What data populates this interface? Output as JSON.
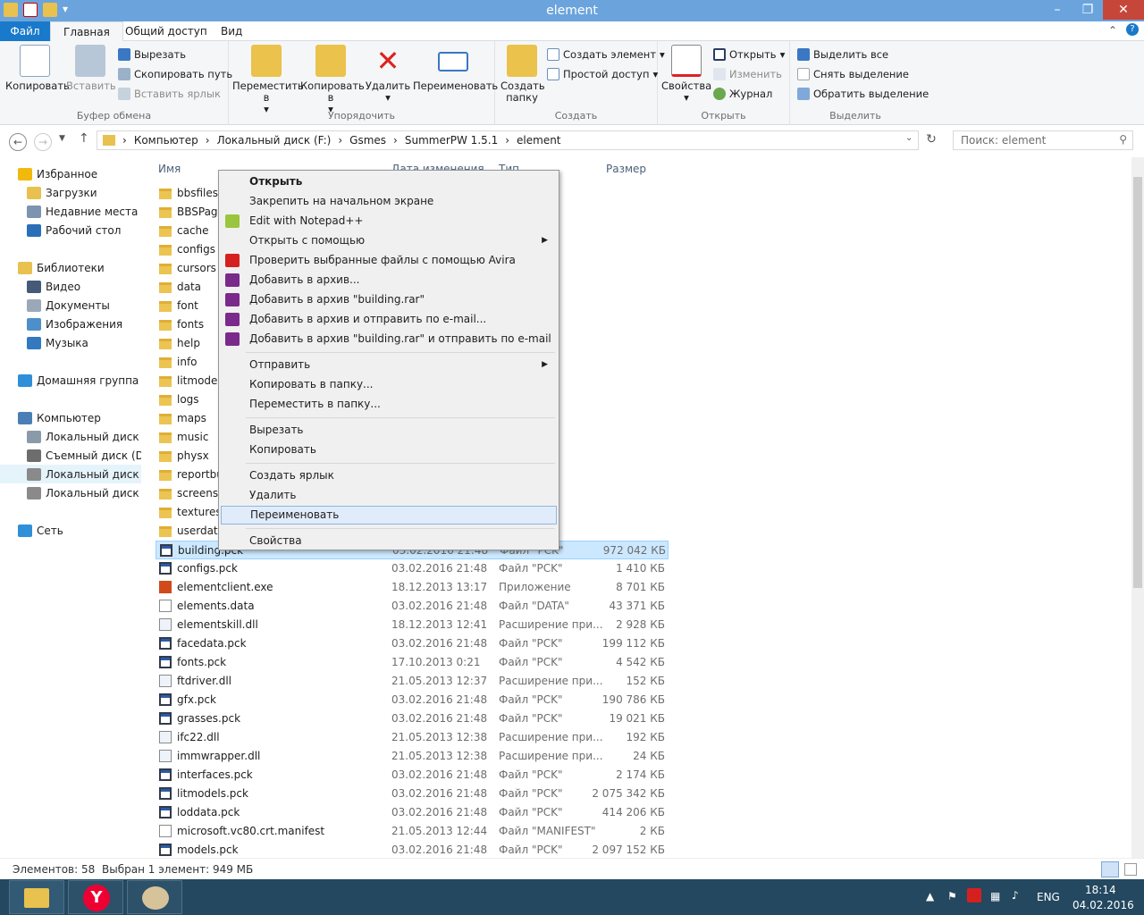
{
  "window": {
    "title": "element",
    "min": "–",
    "max": "❐",
    "close": "✕"
  },
  "menu": {
    "file": "Файл",
    "tabs": [
      "Главная",
      "Общий доступ",
      "Вид"
    ]
  },
  "ribbon": {
    "clipboard": {
      "label": "Буфер обмена",
      "copy": "Копировать",
      "paste": "Вставить",
      "cut": "Вырезать",
      "copy_path": "Скопировать путь",
      "paste_shortcut": "Вставить ярлык"
    },
    "organize": {
      "label": "Упорядочить",
      "move": "Переместить в",
      "copy_to": "Копировать в",
      "delete": "Удалить",
      "rename": "Переименовать"
    },
    "create": {
      "label": "Создать",
      "new_folder": "Создать папку",
      "new_item": "Создать элемент",
      "easy_access": "Простой доступ"
    },
    "open": {
      "label": "Открыть",
      "properties": "Свойства",
      "open": "Открыть",
      "edit": "Изменить",
      "history": "Журнал"
    },
    "select": {
      "label": "Выделить",
      "all": "Выделить все",
      "none": "Снять выделение",
      "invert": "Обратить выделение"
    }
  },
  "address": {
    "crumbs": [
      "Компьютер",
      "Локальный диск (F:)",
      "Gsmes",
      "SummerPW 1.5.1",
      "element"
    ],
    "search_placeholder": "Поиск: element"
  },
  "nav": [
    {
      "label": "Избранное",
      "color": "#f2b90d"
    },
    {
      "label": "Загрузки",
      "color": "#e8c14e"
    },
    {
      "label": "Недавние места",
      "color": "#7c94b0"
    },
    {
      "label": "Рабочий стол",
      "color": "#2b6fb8"
    },
    {
      "label": "Библиотеки",
      "color": "#e8c14e"
    },
    {
      "label": "Видео",
      "color": "#455a78"
    },
    {
      "label": "Документы",
      "color": "#9aa8b8"
    },
    {
      "label": "Изображения",
      "color": "#4d8fc9"
    },
    {
      "label": "Музыка",
      "color": "#3279c0"
    },
    {
      "label": "Домашняя группа",
      "color": "#2f8fd8"
    },
    {
      "label": "Компьютер",
      "color": "#4a7fb5"
    },
    {
      "label": "Локальный диск (C:)",
      "color": "#8a9aa8"
    },
    {
      "label": "Съемный диск (D:)",
      "color": "#6d6d6d"
    },
    {
      "label": "Локальный диск (F:)",
      "color": "#8a8a8a"
    },
    {
      "label": "Локальный диск (L:)",
      "color": "#8a8a8a"
    },
    {
      "label": "Сеть",
      "color": "#2f8fd8"
    }
  ],
  "columns": {
    "name": "Имя",
    "date": "Дата изменения",
    "type": "Тип",
    "size": "Размер"
  },
  "files": [
    {
      "name": "bbsfiles",
      "date": "",
      "type": "лами",
      "size": "",
      "kind": "folder"
    },
    {
      "name": "BBSPages",
      "date": "",
      "type": "лами",
      "size": "",
      "kind": "folder"
    },
    {
      "name": "cache",
      "date": "",
      "type": "лами",
      "size": "",
      "kind": "folder"
    },
    {
      "name": "configs",
      "date": "",
      "type": "лами",
      "size": "",
      "kind": "folder"
    },
    {
      "name": "cursors",
      "date": "",
      "type": "лами",
      "size": "",
      "kind": "folder"
    },
    {
      "name": "data",
      "date": "",
      "type": "лами",
      "size": "",
      "kind": "folder"
    },
    {
      "name": "font",
      "date": "",
      "type": "лами",
      "size": "",
      "kind": "folder"
    },
    {
      "name": "fonts",
      "date": "",
      "type": "лами",
      "size": "",
      "kind": "folder"
    },
    {
      "name": "help",
      "date": "",
      "type": "лами",
      "size": "",
      "kind": "folder"
    },
    {
      "name": "info",
      "date": "",
      "type": "лами",
      "size": "",
      "kind": "folder"
    },
    {
      "name": "litmodels",
      "date": "",
      "type": "лами",
      "size": "",
      "kind": "folder"
    },
    {
      "name": "logs",
      "date": "",
      "type": "лами",
      "size": "",
      "kind": "folder"
    },
    {
      "name": "maps",
      "date": "",
      "type": "лами",
      "size": "",
      "kind": "folder"
    },
    {
      "name": "music",
      "date": "",
      "type": "лами",
      "size": "",
      "kind": "folder"
    },
    {
      "name": "physx",
      "date": "",
      "type": "лами",
      "size": "",
      "kind": "folder"
    },
    {
      "name": "reportbugs",
      "date": "",
      "type": "лами",
      "size": "",
      "kind": "folder"
    },
    {
      "name": "screenshots",
      "date": "",
      "type": "лами",
      "size": "",
      "kind": "folder"
    },
    {
      "name": "textures",
      "date": "",
      "type": "лами",
      "size": "",
      "kind": "folder"
    },
    {
      "name": "userdata",
      "date": "",
      "type": "лами",
      "size": "",
      "kind": "folder"
    },
    {
      "name": "building.pck",
      "date": "03.02.2016 21:48",
      "type": "Файл \"PCK\"",
      "size": "972 042 КБ",
      "kind": "pck",
      "selected": true
    },
    {
      "name": "configs.pck",
      "date": "03.02.2016 21:48",
      "type": "Файл \"PCK\"",
      "size": "1 410 КБ",
      "kind": "pck"
    },
    {
      "name": "elementclient.exe",
      "date": "18.12.2013 13:17",
      "type": "Приложение",
      "size": "8 701 КБ",
      "kind": "exe"
    },
    {
      "name": "elements.data",
      "date": "03.02.2016 21:48",
      "type": "Файл \"DATA\"",
      "size": "43 371 КБ",
      "kind": "file"
    },
    {
      "name": "elementskill.dll",
      "date": "18.12.2013 12:41",
      "type": "Расширение при...",
      "size": "2 928 КБ",
      "kind": "dll"
    },
    {
      "name": "facedata.pck",
      "date": "03.02.2016 21:48",
      "type": "Файл \"PCK\"",
      "size": "199 112 КБ",
      "kind": "pck"
    },
    {
      "name": "fonts.pck",
      "date": "17.10.2013 0:21",
      "type": "Файл \"PCK\"",
      "size": "4 542 КБ",
      "kind": "pck"
    },
    {
      "name": "ftdriver.dll",
      "date": "21.05.2013 12:37",
      "type": "Расширение при...",
      "size": "152 КБ",
      "kind": "dll"
    },
    {
      "name": "gfx.pck",
      "date": "03.02.2016 21:48",
      "type": "Файл \"PCK\"",
      "size": "190 786 КБ",
      "kind": "pck"
    },
    {
      "name": "grasses.pck",
      "date": "03.02.2016 21:48",
      "type": "Файл \"PCK\"",
      "size": "19 021 КБ",
      "kind": "pck"
    },
    {
      "name": "ifc22.dll",
      "date": "21.05.2013 12:38",
      "type": "Расширение при...",
      "size": "192 КБ",
      "kind": "dll"
    },
    {
      "name": "immwrapper.dll",
      "date": "21.05.2013 12:38",
      "type": "Расширение при...",
      "size": "24 КБ",
      "kind": "dll"
    },
    {
      "name": "interfaces.pck",
      "date": "03.02.2016 21:48",
      "type": "Файл \"PCK\"",
      "size": "2 174 КБ",
      "kind": "pck"
    },
    {
      "name": "litmodels.pck",
      "date": "03.02.2016 21:48",
      "type": "Файл \"PCK\"",
      "size": "2 075 342 КБ",
      "kind": "pck"
    },
    {
      "name": "loddata.pck",
      "date": "03.02.2016 21:48",
      "type": "Файл \"PCK\"",
      "size": "414 206 КБ",
      "kind": "pck"
    },
    {
      "name": "microsoft.vc80.crt.manifest",
      "date": "21.05.2013 12:44",
      "type": "Файл \"MANIFEST\"",
      "size": "2 КБ",
      "kind": "file"
    },
    {
      "name": "models.pck",
      "date": "03.02.2016 21:48",
      "type": "Файл \"PCK\"",
      "size": "2 097 152 КБ",
      "kind": "pck"
    }
  ],
  "context_menu": [
    {
      "label": "Открыть",
      "bold": true
    },
    {
      "label": "Закрепить на начальном экране"
    },
    {
      "label": "Edit with Notepad++",
      "icon": "notepad-icon",
      "color": "#9bc53d"
    },
    {
      "label": "Открыть с помощью",
      "submenu": true
    },
    {
      "label": "Проверить выбранные файлы с помощью Avira",
      "icon": "avira-icon",
      "color": "#d6201f"
    },
    {
      "label": "Добавить в архив...",
      "icon": "winrar-icon",
      "color": "#7a2a8a"
    },
    {
      "label": "Добавить в архив \"building.rar\"",
      "icon": "winrar-icon",
      "color": "#7a2a8a"
    },
    {
      "label": "Добавить в архив и отправить по e-mail...",
      "icon": "winrar-icon",
      "color": "#7a2a8a"
    },
    {
      "label": "Добавить в архив \"building.rar\" и отправить по e-mail",
      "icon": "winrar-icon",
      "color": "#7a2a8a",
      "sep_after": true
    },
    {
      "label": "Отправить",
      "submenu": true
    },
    {
      "label": "Копировать в папку..."
    },
    {
      "label": "Переместить в папку...",
      "sep_after": true
    },
    {
      "label": "Вырезать"
    },
    {
      "label": "Копировать",
      "sep_after": true
    },
    {
      "label": "Создать ярлык"
    },
    {
      "label": "Удалить"
    },
    {
      "label": "Переименовать",
      "highlight": true,
      "sep_after": true
    },
    {
      "label": "Свойства"
    }
  ],
  "status": {
    "count": "Элементов: 58",
    "selected": "Выбран 1 элемент: 949 МБ"
  },
  "taskbar": {
    "lang": "ENG",
    "time": "18:14",
    "date": "04.02.2016"
  }
}
